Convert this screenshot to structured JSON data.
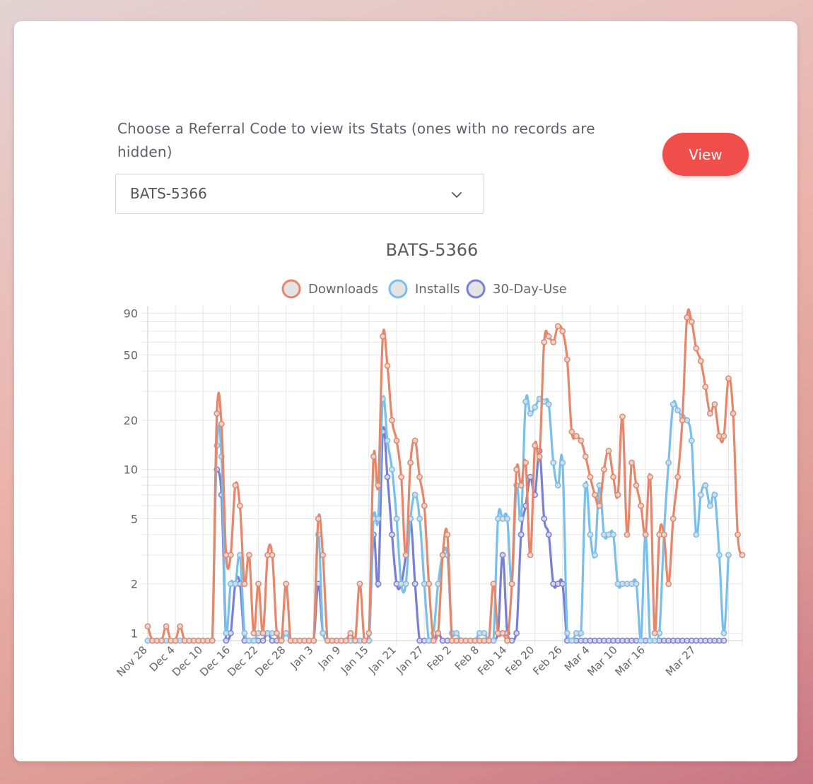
{
  "form": {
    "prompt": "Choose a Referral Code to view its Stats (ones with no records are hidden)",
    "selected_code": "BATS-5366",
    "view_label": "View"
  },
  "colors": {
    "downloads": "#e8866a",
    "installs": "#79bfec",
    "use30": "#7a7fd6",
    "button": "#ef4e4a"
  },
  "chart_data": {
    "type": "line",
    "title": "BATS-5366",
    "xlabel": "",
    "ylabel": "",
    "y_scale": "log",
    "ylim": [
      0.9,
      100
    ],
    "y_ticks": [
      "1",
      "2",
      "5",
      "10",
      "20",
      "50",
      "90"
    ],
    "grid": true,
    "legend_position": "top",
    "x_start": "Nov 28",
    "x_tick_labels": [
      "Nov 28",
      "Dec 4",
      "Dec 10",
      "Dec 16",
      "Dec 22",
      "Dec 28",
      "Jan 3",
      "Jan 9",
      "Jan 15",
      "Jan 21",
      "Jan 27",
      "Feb 2",
      "Feb 8",
      "Feb 14",
      "Feb 20",
      "Feb 26",
      "Mar 4",
      "Mar 10",
      "Mar 16",
      "Mar 27"
    ],
    "x_tick_index": [
      0,
      6,
      12,
      18,
      24,
      30,
      36,
      42,
      48,
      54,
      60,
      66,
      72,
      78,
      84,
      90,
      96,
      102,
      108,
      119
    ],
    "series": [
      {
        "name": "Downloads",
        "values": [
          1.1,
          0.9,
          0.9,
          0.9,
          1.1,
          0.9,
          0.9,
          1.1,
          0.9,
          0.9,
          0.9,
          0.9,
          0.9,
          0.9,
          0.9,
          22,
          19,
          3,
          3,
          8,
          6,
          2,
          3,
          1,
          2,
          1,
          3,
          3,
          1,
          0.9,
          2,
          0.9,
          0.9,
          0.9,
          0.9,
          0.9,
          0.9,
          5,
          3,
          0.9,
          0.9,
          0.9,
          0.9,
          0.9,
          1,
          0.9,
          2,
          0.9,
          1,
          12,
          8,
          65,
          43,
          20,
          15,
          9,
          3,
          11,
          15,
          9,
          6,
          2,
          0.9,
          1,
          3,
          4,
          0.9,
          0.9,
          0.9,
          0.9,
          0.9,
          0.9,
          0.9,
          0.9,
          0.9,
          2,
          1,
          1,
          0.9,
          2,
          10,
          8,
          11,
          3,
          14,
          12,
          60,
          65,
          60,
          75,
          70,
          47,
          17,
          16,
          15,
          12,
          9,
          7,
          6,
          10,
          13,
          9,
          7,
          21,
          4,
          11,
          8,
          6,
          4,
          9,
          1,
          4,
          4,
          2,
          5,
          9,
          20,
          85,
          80,
          55,
          46,
          32,
          22,
          25,
          16,
          16,
          36,
          22,
          4,
          3
        ]
      },
      {
        "name": "Installs",
        "values": [
          0.9,
          0.9,
          0.9,
          0.9,
          0.9,
          0.9,
          0.9,
          0.9,
          0.9,
          0.9,
          0.9,
          0.9,
          0.9,
          0.9,
          0.9,
          14,
          12,
          1,
          2,
          2,
          3,
          1,
          0.9,
          0.9,
          1,
          1,
          1,
          1,
          1,
          0.9,
          1,
          0.9,
          0.9,
          0.9,
          0.9,
          0.9,
          0.9,
          4,
          1,
          0.9,
          0.9,
          0.9,
          0.9,
          0.9,
          0.9,
          0.9,
          0.9,
          0.9,
          0.9,
          5,
          5,
          27,
          15,
          10,
          5,
          2,
          2,
          5,
          7,
          5,
          2,
          0.9,
          1,
          2,
          3,
          3,
          1,
          1,
          0.9,
          0.9,
          0.9,
          0.9,
          1,
          1,
          0.9,
          0.9,
          5,
          5,
          5,
          2,
          8,
          5,
          26,
          22,
          24,
          27,
          26,
          25,
          11,
          8,
          11,
          1,
          0.9,
          1,
          1,
          8,
          4,
          3,
          8,
          4,
          4,
          4,
          2,
          2,
          2,
          2,
          2,
          0.9,
          4,
          0.9,
          0.9,
          1,
          4,
          11,
          25,
          23,
          21,
          20,
          15,
          4,
          7,
          8,
          6,
          7,
          3,
          1,
          3
        ]
      },
      {
        "name": "30-Day-Use",
        "values": [
          null,
          null,
          null,
          null,
          null,
          null,
          null,
          null,
          null,
          null,
          null,
          null,
          null,
          null,
          null,
          10,
          7,
          0.9,
          1,
          2,
          2,
          0.9,
          0.9,
          0.9,
          0.9,
          0.9,
          1,
          0.9,
          0.9,
          0.9,
          1,
          0.9,
          0.9,
          0.9,
          0.9,
          0.9,
          0.9,
          2,
          1,
          0.9,
          0.9,
          0.9,
          0.9,
          0.9,
          0.9,
          0.9,
          0.9,
          0.9,
          0.9,
          4,
          2,
          17,
          9,
          4,
          2,
          2,
          3,
          5,
          2,
          0.9,
          0.9,
          0.9,
          0.9,
          1,
          0.9,
          0.9,
          0.9,
          0.9,
          0.9,
          0.9,
          0.9,
          0.9,
          0.9,
          0.9,
          0.9,
          0.9,
          1,
          3,
          1,
          0.9,
          1,
          4,
          6,
          9,
          7,
          13,
          5,
          4,
          2,
          2,
          2,
          0.9,
          0.9,
          0.9,
          0.9,
          0.9,
          0.9,
          0.9,
          0.9,
          0.9,
          0.9,
          0.9,
          0.9,
          0.9,
          0.9,
          0.9,
          0.9,
          0.9,
          0.9,
          0.9,
          0.9,
          0.9,
          0.9,
          0.9,
          0.9,
          0.9,
          0.9,
          0.9,
          0.9,
          0.9,
          0.9,
          0.9,
          0.9,
          0.9,
          0.9,
          0.9
        ]
      }
    ]
  }
}
